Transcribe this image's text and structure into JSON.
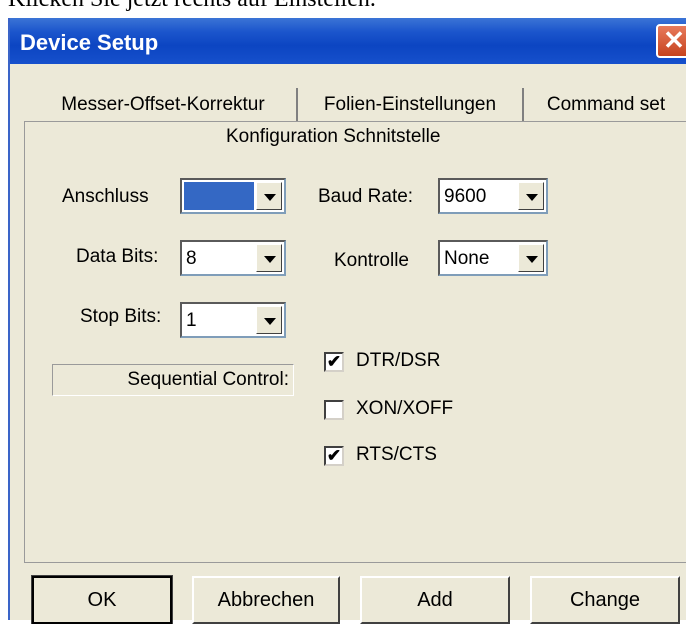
{
  "above_text": "Klicken Sie jetzt rechts auf Einstellen.",
  "window": {
    "title": "Device Setup",
    "close_glyph": "✕"
  },
  "tabs": [
    "Messer-Offset-Korrektur",
    "Folien-Einstellungen",
    "Command set"
  ],
  "panel_heading": "Konfiguration Schnitstelle",
  "fields": {
    "anschluss": {
      "label": "Anschluss",
      "value": ""
    },
    "baud_rate": {
      "label": "Baud Rate:",
      "value": "9600"
    },
    "data_bits": {
      "label": "Data Bits:",
      "value": "8"
    },
    "kontrolle": {
      "label": "Kontrolle",
      "value": "None"
    },
    "stop_bits": {
      "label": "Stop Bits:",
      "value": "1"
    }
  },
  "sequential_control": "Sequential Control:",
  "checkboxes": [
    {
      "label": "DTR/DSR",
      "checked": true,
      "mark": "✔"
    },
    {
      "label": "XON/XOFF",
      "checked": false,
      "mark": ""
    },
    {
      "label": "RTS/CTS",
      "checked": true,
      "mark": "✔"
    }
  ],
  "buttons": {
    "ok": "OK",
    "cancel": "Abbrechen",
    "add": "Add",
    "change": "Change"
  }
}
